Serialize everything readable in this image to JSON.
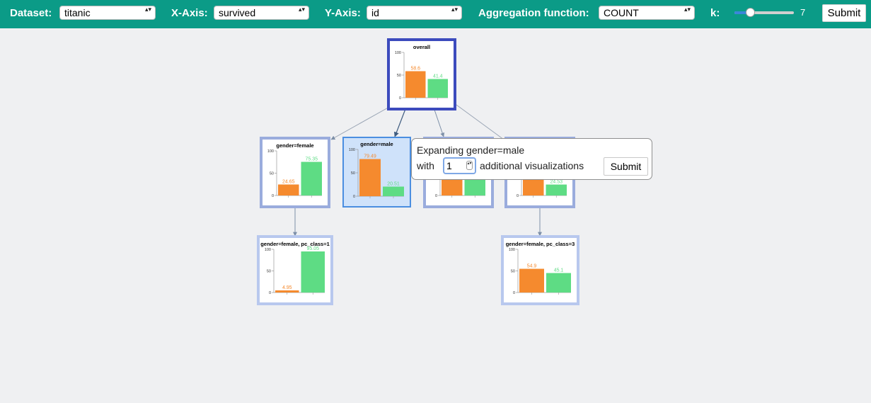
{
  "toolbar": {
    "dataset_label": "Dataset:",
    "dataset_value": "titanic",
    "xaxis_label": "X-Axis:",
    "xaxis_value": "survived",
    "yaxis_label": "Y-Axis:",
    "yaxis_value": "id",
    "agg_label": "Aggregation function:",
    "agg_value": "COUNT",
    "k_label": "k:",
    "k_value": "7",
    "k_slider_fraction": 0.26,
    "submit_label": "Submit",
    "caret_glyph": "▴▾"
  },
  "colors": {
    "toolbar_bg": "#0b9b87",
    "bar_orange": "#f58a2e",
    "bar_green": "#5edc84"
  },
  "popup": {
    "line1": "Expanding gender=male",
    "with_label": "with",
    "count_value": "1",
    "after_label": "additional visualizations",
    "submit_label": "Submit",
    "spin_glyph": "▴▾"
  },
  "nodes": [
    {
      "id": "overall",
      "title": "overall",
      "ymax": "100",
      "ymid": "50",
      "ymin": "0",
      "v1": "58.6",
      "v2": "41.4",
      "h1": 58.6,
      "h2": 41.4
    },
    {
      "id": "female",
      "title": "gender=female",
      "ymax": "100",
      "ymid": "50",
      "ymin": "0",
      "v1": "24.65",
      "v2": "75.35",
      "h1": 24.65,
      "h2": 75.35
    },
    {
      "id": "male",
      "title": "gender=male",
      "ymax": "100",
      "ymid": "50",
      "ymin": "0",
      "v1": "79.49",
      "v2": "20.51",
      "h1": 79.49,
      "h2": 20.51
    },
    {
      "id": "hidden3",
      "title": "",
      "ymax": "100",
      "ymid": "50",
      "ymin": "0",
      "v1": "",
      "v2": "",
      "h1": 38,
      "h2": 40
    },
    {
      "id": "hidden4",
      "title": "",
      "ymax": "100",
      "ymid": "50",
      "ymin": "0",
      "v1": "",
      "v2": "24.53",
      "h1": 42,
      "h2": 24.53
    },
    {
      "id": "female_pc1",
      "title": "gender=female, pc_class=1",
      "ymax": "100",
      "ymid": "50",
      "ymin": "0",
      "v1": "4.95",
      "v2": "95.05",
      "h1": 4.95,
      "h2": 95.05
    },
    {
      "id": "female_pc3",
      "title": "gender=female, pc_class=3",
      "ymax": "100",
      "ymid": "50",
      "ymin": "0",
      "v1": "54.9",
      "v2": "45.1",
      "h1": 54.9,
      "h2": 45.1
    }
  ]
}
